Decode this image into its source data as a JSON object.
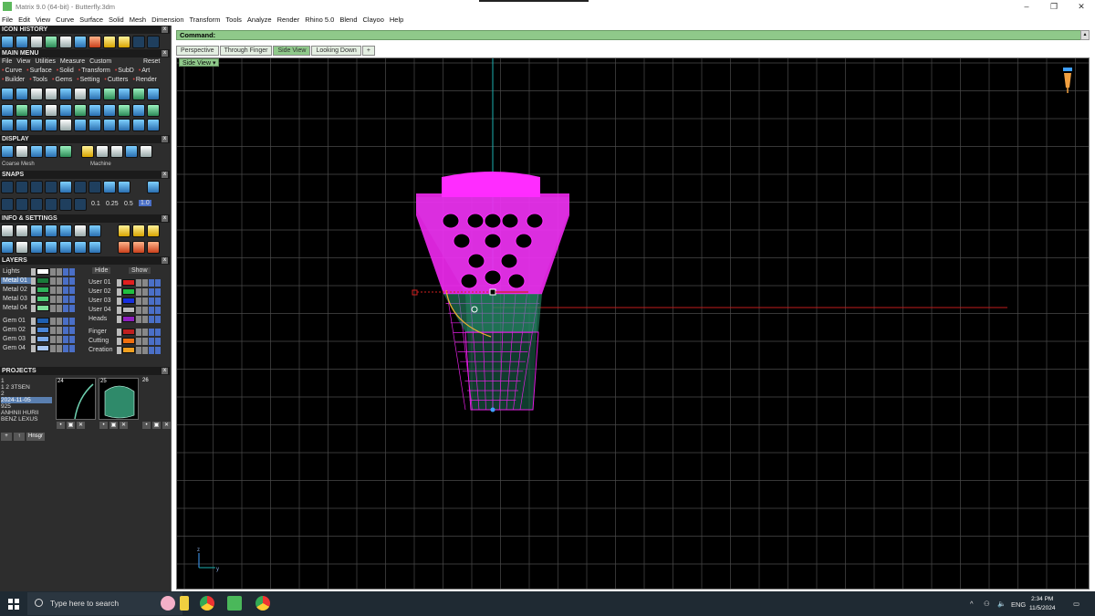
{
  "titlebar": {
    "title": "Matrix 9.0 (64-bit) - Butterfly.3dm",
    "minimize": "–",
    "maximize": "❐",
    "close": "✕"
  },
  "menu": [
    "File",
    "Edit",
    "View",
    "Curve",
    "Surface",
    "Solid",
    "Mesh",
    "Dimension",
    "Transform",
    "Tools",
    "Analyze",
    "Render",
    "Rhino 5.0",
    "Blend",
    "Clayoo",
    "Help"
  ],
  "left": {
    "icon_history": "ICON HISTORY",
    "main_menu": "MAIN MENU",
    "main_menu_row1": [
      "File",
      "View",
      "Utilities",
      "Measure",
      "Custom"
    ],
    "main_menu_reset": "Reset",
    "main_menu_row2": [
      "Curve",
      "Surface",
      "Solid",
      "Transform",
      "SubD",
      "Art"
    ],
    "main_menu_row3": [
      "Builder",
      "Tools",
      "Gems",
      "Setting",
      "Cutters",
      "Render"
    ],
    "display": "DISPLAY",
    "display_left_label": "Coarse Mesh",
    "display_right_label": "Machine",
    "snaps": "SNAPS",
    "snap_values": [
      "0.1",
      "0.25",
      "0.5",
      "1.0"
    ],
    "info": "INFO & SETTINGS",
    "layers": "LAYERS",
    "hide": "Hide",
    "show": "Show",
    "layers_left": [
      {
        "name": "Lights",
        "color": "#ffffff",
        "selected": false
      },
      {
        "name": "Metal 01",
        "color": "#1a7a3a",
        "selected": true
      },
      {
        "name": "Metal 02",
        "color": "#2eb35a",
        "selected": false
      },
      {
        "name": "Metal 03",
        "color": "#4dcc77",
        "selected": false
      },
      {
        "name": "Metal 04",
        "color": "#7ee09b",
        "selected": false
      },
      {
        "name": "Gem 01",
        "color": "#1e5fb0",
        "selected": false
      },
      {
        "name": "Gem 02",
        "color": "#4a86d8",
        "selected": false
      },
      {
        "name": "Gem 03",
        "color": "#79a9ea",
        "selected": false
      },
      {
        "name": "Gem 04",
        "color": "#a9c7f2",
        "selected": false
      }
    ],
    "layers_right": [
      {
        "name": "User 01",
        "color": "#e02020"
      },
      {
        "name": "User 02",
        "color": "#20c040"
      },
      {
        "name": "User 03",
        "color": "#1830e0"
      },
      {
        "name": "User 04",
        "color": "#bbbbbb"
      },
      {
        "name": "Heads",
        "color": "#9020c0"
      },
      {
        "name": "Finger",
        "color": "#c02020"
      },
      {
        "name": "Cutting",
        "color": "#f07010"
      },
      {
        "name": "Creation",
        "color": "#f0a020"
      }
    ],
    "projects": "PROJECTS",
    "project_list": [
      "1",
      "1 2 3TSEN",
      "2",
      "2024-11-05",
      "925",
      "ANHNII HURII",
      "BENZ LEXUS"
    ],
    "project_selected": "2024-11-05",
    "thumbs": [
      "24",
      "25",
      "26"
    ],
    "hnsgr": "Hnsgr"
  },
  "command": {
    "label": "Command:"
  },
  "tabs": [
    {
      "label": "Perspective",
      "active": false
    },
    {
      "label": "Through Finger",
      "active": false
    },
    {
      "label": "Side View",
      "active": true
    },
    {
      "label": "Looking Down",
      "active": false
    }
  ],
  "tab_add": "+",
  "view_dropdown": "Side View",
  "taskbar": {
    "search_placeholder": "Type here to search",
    "language": "ENG",
    "time": "2:34 PM",
    "date": "11/5/2024"
  }
}
